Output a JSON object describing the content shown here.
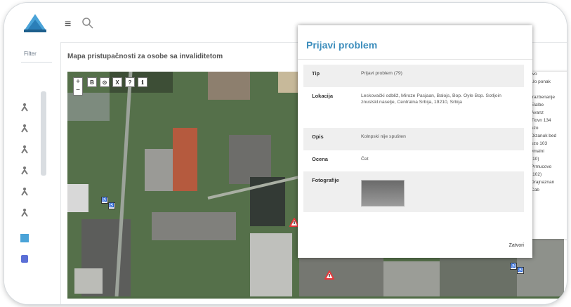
{
  "header": {
    "menu_icon": "hamburger-icon",
    "search_icon": "search-icon"
  },
  "sidebar": {
    "filter_label": "Filter",
    "icons": [
      "accessibility-icon",
      "accessibility-icon",
      "accessibility-icon",
      "accessibility-icon",
      "accessibility-icon",
      "accessibility-icon",
      "parking-icon",
      "bus-icon"
    ]
  },
  "map": {
    "title": "Mapa pristupačnosti za osobe sa invaliditetom",
    "tools": [
      "+",
      "B",
      "⊙",
      "X",
      "?",
      "ℹ"
    ]
  },
  "modal": {
    "title": "Prijavi problem",
    "rows": [
      {
        "key": "Tip",
        "value": "Prijavi problem (79)"
      },
      {
        "key": "Lokacija",
        "value": "Leskovački odbliž, Miroze Pasjaan, Balojs, Bop. Oyle Bop. Sotljoin znuslskl.naselje, Centralna Srbija, 19210, Srbija"
      },
      {
        "key": "Opis",
        "value": "Kolnpski nije spušten"
      },
      {
        "key": "Ocena",
        "value": "Čet"
      },
      {
        "key": "Fotografije",
        "value": ""
      }
    ],
    "close_label": "Zatvori"
  },
  "legend": {
    "items": [
      "Ivo",
      "Uo ponak",
      "",
      "trazbenanje",
      "Elalbe",
      "Avanz",
      "Tlovn 134",
      "uzo",
      "Dizanuk bed",
      "uzo 103",
      "vmalni",
      "(10)",
      "Prmucovo",
      "(102)",
      "Drajnaznan",
      "Cab"
    ]
  },
  "colors": {
    "accent": "#3c8dbc",
    "warning": "#e7383b"
  }
}
